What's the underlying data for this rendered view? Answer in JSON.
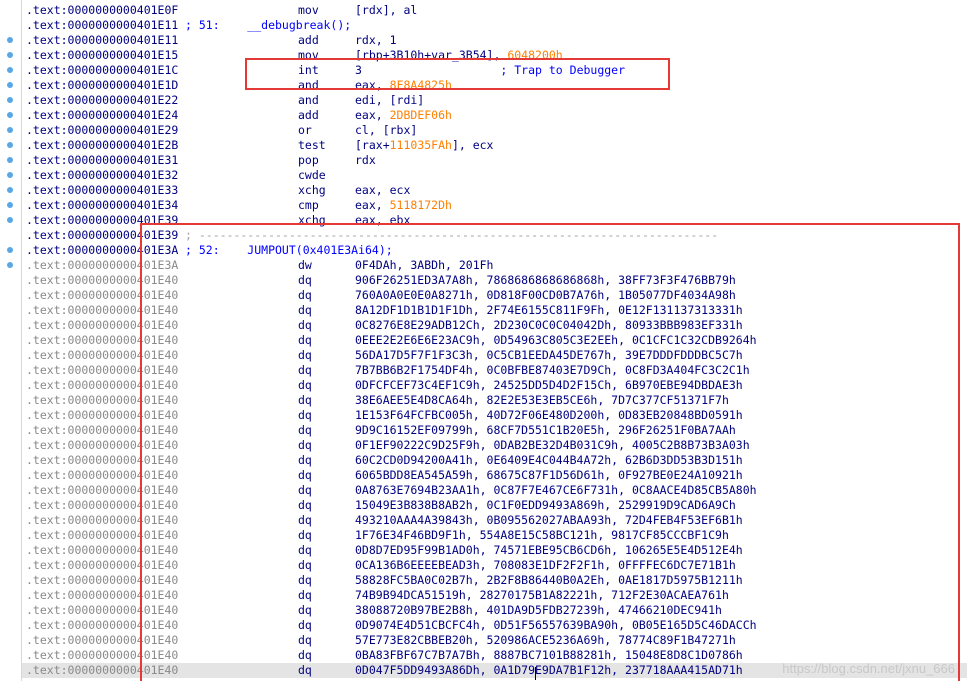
{
  "disasm": {
    "rows": [
      {
        "addr": ".text:0000000000401E0F",
        "kind": "ins",
        "mnem": "mov",
        "ops": [
          {
            "t": "[rdx], al"
          }
        ]
      },
      {
        "addr": ".text:0000000000401E11",
        "kind": "pseudo",
        "text": "; 51:    __debugbreak();"
      },
      {
        "addr": ".text:0000000000401E11",
        "kind": "ins",
        "mnem": "add",
        "ops": [
          {
            "t": "rdx, 1"
          }
        ]
      },
      {
        "addr": ".text:0000000000401E15",
        "kind": "ins",
        "mnem": "mov",
        "ops": [
          {
            "t": "[rbp+3B10h+var_3B54], "
          },
          {
            "n": "6048200h"
          }
        ]
      },
      {
        "addr": ".text:0000000000401E1C",
        "kind": "ins",
        "mnem": "int",
        "ops": [
          {
            "t": "3                    "
          },
          {
            "c": "; Trap to Debugger"
          }
        ]
      },
      {
        "addr": ".text:0000000000401E1D",
        "kind": "ins",
        "mnem": "and",
        "ops": [
          {
            "t": "eax, "
          },
          {
            "n": "8F8A4825h"
          }
        ]
      },
      {
        "addr": ".text:0000000000401E22",
        "kind": "ins",
        "mnem": "and",
        "ops": [
          {
            "t": "edi, [rdi]"
          }
        ]
      },
      {
        "addr": ".text:0000000000401E24",
        "kind": "ins",
        "mnem": "add",
        "ops": [
          {
            "t": "eax, "
          },
          {
            "n": "2DBDEF06h"
          }
        ]
      },
      {
        "addr": ".text:0000000000401E29",
        "kind": "ins",
        "mnem": "or",
        "ops": [
          {
            "t": "cl, [rbx]"
          }
        ]
      },
      {
        "addr": ".text:0000000000401E2B",
        "kind": "ins",
        "mnem": "test",
        "ops": [
          {
            "t": "[rax+"
          },
          {
            "n": "111035FAh"
          },
          {
            "t": "], ecx"
          }
        ]
      },
      {
        "addr": ".text:0000000000401E31",
        "kind": "ins",
        "mnem": "pop",
        "ops": [
          {
            "t": "rdx"
          }
        ]
      },
      {
        "addr": ".text:0000000000401E32",
        "kind": "ins",
        "mnem": "cwde",
        "ops": []
      },
      {
        "addr": ".text:0000000000401E33",
        "kind": "ins",
        "mnem": "xchg",
        "ops": [
          {
            "t": "eax, ecx"
          }
        ]
      },
      {
        "addr": ".text:0000000000401E34",
        "kind": "ins",
        "mnem": "cmp",
        "ops": [
          {
            "t": "eax, "
          },
          {
            "n": "5118172Dh"
          }
        ]
      },
      {
        "addr": ".text:0000000000401E39",
        "kind": "ins",
        "mnem": "xchg",
        "ops": [
          {
            "t": "eax, ebx"
          }
        ]
      },
      {
        "addr": ".text:0000000000401E39",
        "kind": "sep",
        "text": "; ---------------------------------------------------------------------------"
      },
      {
        "addr": ".text:0000000000401E3A",
        "kind": "pseudo",
        "text": "; 52:    JUMPOUT(0x401E3Ai64);"
      },
      {
        "addr": ".text:0000000000401E3A",
        "kind": "data",
        "mnem": "dw",
        "ops": [
          {
            "t": "0F4DAh, 3ABDh, 201Fh"
          }
        ]
      },
      {
        "addr": ".text:0000000000401E40",
        "kind": "data",
        "mnem": "dq",
        "ops": [
          {
            "t": "906F26251ED3A7A8h, 7868686868686868h, 38FF73F3F476BB79h"
          }
        ]
      },
      {
        "addr": ".text:0000000000401E40",
        "kind": "data",
        "mnem": "dq",
        "ops": [
          {
            "t": "760A0A0E0E0A8271h, 0D818F00CD0B7A76h, 1B05077DF4034A98h"
          }
        ]
      },
      {
        "addr": ".text:0000000000401E40",
        "kind": "data",
        "mnem": "dq",
        "ops": [
          {
            "t": "8A12DF1D1B1D1F1Dh, 2F74E6155C811F9Fh, 0E12F131137313331h"
          }
        ]
      },
      {
        "addr": ".text:0000000000401E40",
        "kind": "data",
        "mnem": "dq",
        "ops": [
          {
            "t": "0C8276E8E29ADB12Ch, 2D230C0C0C04042Dh, 80933BBB983EF331h"
          }
        ]
      },
      {
        "addr": ".text:0000000000401E40",
        "kind": "data",
        "mnem": "dq",
        "ops": [
          {
            "t": "0EEE2E2E6E6E23AC9h, 0D54963C805C3E2EEh, 0C1CFC1C32CDB9264h"
          }
        ]
      },
      {
        "addr": ".text:0000000000401E40",
        "kind": "data",
        "mnem": "dq",
        "ops": [
          {
            "t": "56DA17D5F7F1F3C3h, 0C5CB1EEDA45DE767h, 39E7DDDFDDDBC5C7h"
          }
        ]
      },
      {
        "addr": ".text:0000000000401E40",
        "kind": "data",
        "mnem": "dq",
        "ops": [
          {
            "t": "7B7BB6B2F1754DF4h, 0C0BFBE87403E7D9Ch, 0C8FD3A404FC3C2C1h"
          }
        ]
      },
      {
        "addr": ".text:0000000000401E40",
        "kind": "data",
        "mnem": "dq",
        "ops": [
          {
            "t": "0DFCFCEF73C4EF1C9h, 24525DD5D4D2F15Ch, 6B970EBE94DBDAE3h"
          }
        ]
      },
      {
        "addr": ".text:0000000000401E40",
        "kind": "data",
        "mnem": "dq",
        "ops": [
          {
            "t": "38E6AEE5E4D8CA64h, 82E2E53E3EB5CE6h, 7D7C377CF51371F7h"
          }
        ]
      },
      {
        "addr": ".text:0000000000401E40",
        "kind": "data",
        "mnem": "dq",
        "ops": [
          {
            "t": "1E153F64FCFBC005h, 40D72F06E480D200h, 0D83EB20848BD0591h"
          }
        ]
      },
      {
        "addr": ".text:0000000000401E40",
        "kind": "data",
        "mnem": "dq",
        "ops": [
          {
            "t": "9D9C16152EF09799h, 68CF7D551C1B20E5h, 296F26251F0BA7AAh"
          }
        ]
      },
      {
        "addr": ".text:0000000000401E40",
        "kind": "data",
        "mnem": "dq",
        "ops": [
          {
            "t": "0F1EF90222C9D25F9h, 0DAB2BE32D4B031C9h, 4005C2B8B73B3A03h"
          }
        ]
      },
      {
        "addr": ".text:0000000000401E40",
        "kind": "data",
        "mnem": "dq",
        "ops": [
          {
            "t": "60C2CD0D94200A41h, 0E6409E4C044B4A72h, 62B6D3DD53B3D151h"
          }
        ]
      },
      {
        "addr": ".text:0000000000401E40",
        "kind": "data",
        "mnem": "dq",
        "ops": [
          {
            "t": "6065BDD8EA545A59h, 68675C87F1D56D61h, 0F927BE0E24A10921h"
          }
        ]
      },
      {
        "addr": ".text:0000000000401E40",
        "kind": "data",
        "mnem": "dq",
        "ops": [
          {
            "t": "0A8763E7694B23AA1h, 0C87F7E467CE6F731h, 0C8AACE4D85CB5A80h"
          }
        ]
      },
      {
        "addr": ".text:0000000000401E40",
        "kind": "data",
        "mnem": "dq",
        "ops": [
          {
            "t": "15049E3B838B8AB2h, 0C1F0EDD9493A869h, 2529919D9CAD6A9Ch"
          }
        ]
      },
      {
        "addr": ".text:0000000000401E40",
        "kind": "data",
        "mnem": "dq",
        "ops": [
          {
            "t": "493210AAA4A39843h, 0B095562027ABAA93h, 72D4FEB4F53EF6B1h"
          }
        ]
      },
      {
        "addr": ".text:0000000000401E40",
        "kind": "data",
        "mnem": "dq",
        "ops": [
          {
            "t": "1F76E34F46BD9F1h, 554A8E15C58BC121h, 9817CF85CCCBF1C9h"
          }
        ]
      },
      {
        "addr": ".text:0000000000401E40",
        "kind": "data",
        "mnem": "dq",
        "ops": [
          {
            "t": "0D8D7ED95F99B1AD0h, 74571EBE95CB6CD6h, 106265E5E4D512E4h"
          }
        ]
      },
      {
        "addr": ".text:0000000000401E40",
        "kind": "data",
        "mnem": "dq",
        "ops": [
          {
            "t": "0CA136B6EEEEBEAD3h, 708083E1DF2F2F1h, 0FFFFEC6DC7E71B1h"
          }
        ]
      },
      {
        "addr": ".text:0000000000401E40",
        "kind": "data",
        "mnem": "dq",
        "ops": [
          {
            "t": "58828FC5BA0C02B7h, 2B2F8B86440B0A2Eh, 0AE1817D5975B1211h"
          }
        ]
      },
      {
        "addr": ".text:0000000000401E40",
        "kind": "data",
        "mnem": "dq",
        "ops": [
          {
            "t": "74B9B94DCA51519h, 28270175B1A82221h, 712F2E30ACAEA761h"
          }
        ]
      },
      {
        "addr": ".text:0000000000401E40",
        "kind": "data",
        "mnem": "dq",
        "ops": [
          {
            "t": "38088720B97BE2B8h, 401DA9D5FDB27239h, 47466210DEC941h"
          }
        ]
      },
      {
        "addr": ".text:0000000000401E40",
        "kind": "data",
        "mnem": "dq",
        "ops": [
          {
            "t": "0D9074E4D51CBCFC4h, 0D51F56557639BA90h, 0B05E165D5C46DACCh"
          }
        ]
      },
      {
        "addr": ".text:0000000000401E40",
        "kind": "data",
        "mnem": "dq",
        "ops": [
          {
            "t": "57E773E82CBBEB20h, 520986ACE5236A69h, 78774C89F1B47271h"
          }
        ]
      },
      {
        "addr": ".text:0000000000401E40",
        "kind": "data",
        "mnem": "dq",
        "ops": [
          {
            "t": "0BA83FBF67C7B7A7Bh, 8887BC7101B88281h, 15048E8D8C1D0786h"
          }
        ]
      },
      {
        "addr": ".text:0000000000401E40",
        "kind": "data",
        "mnem": "dq",
        "ops": [
          {
            "t": "0D047F5DD9493A86Dh, 0A1D79E9DA7B1F12h, 237718AAA415AD71h"
          }
        ],
        "selected": true
      }
    ]
  },
  "watermark": "https://blog.csdn.net/jxnu_666",
  "colors": {
    "address": "#000080",
    "number": "#ff8000",
    "comment": "#0000ff",
    "highlight": "#e53935",
    "breakpoint_dot": "#5aa7e6"
  }
}
